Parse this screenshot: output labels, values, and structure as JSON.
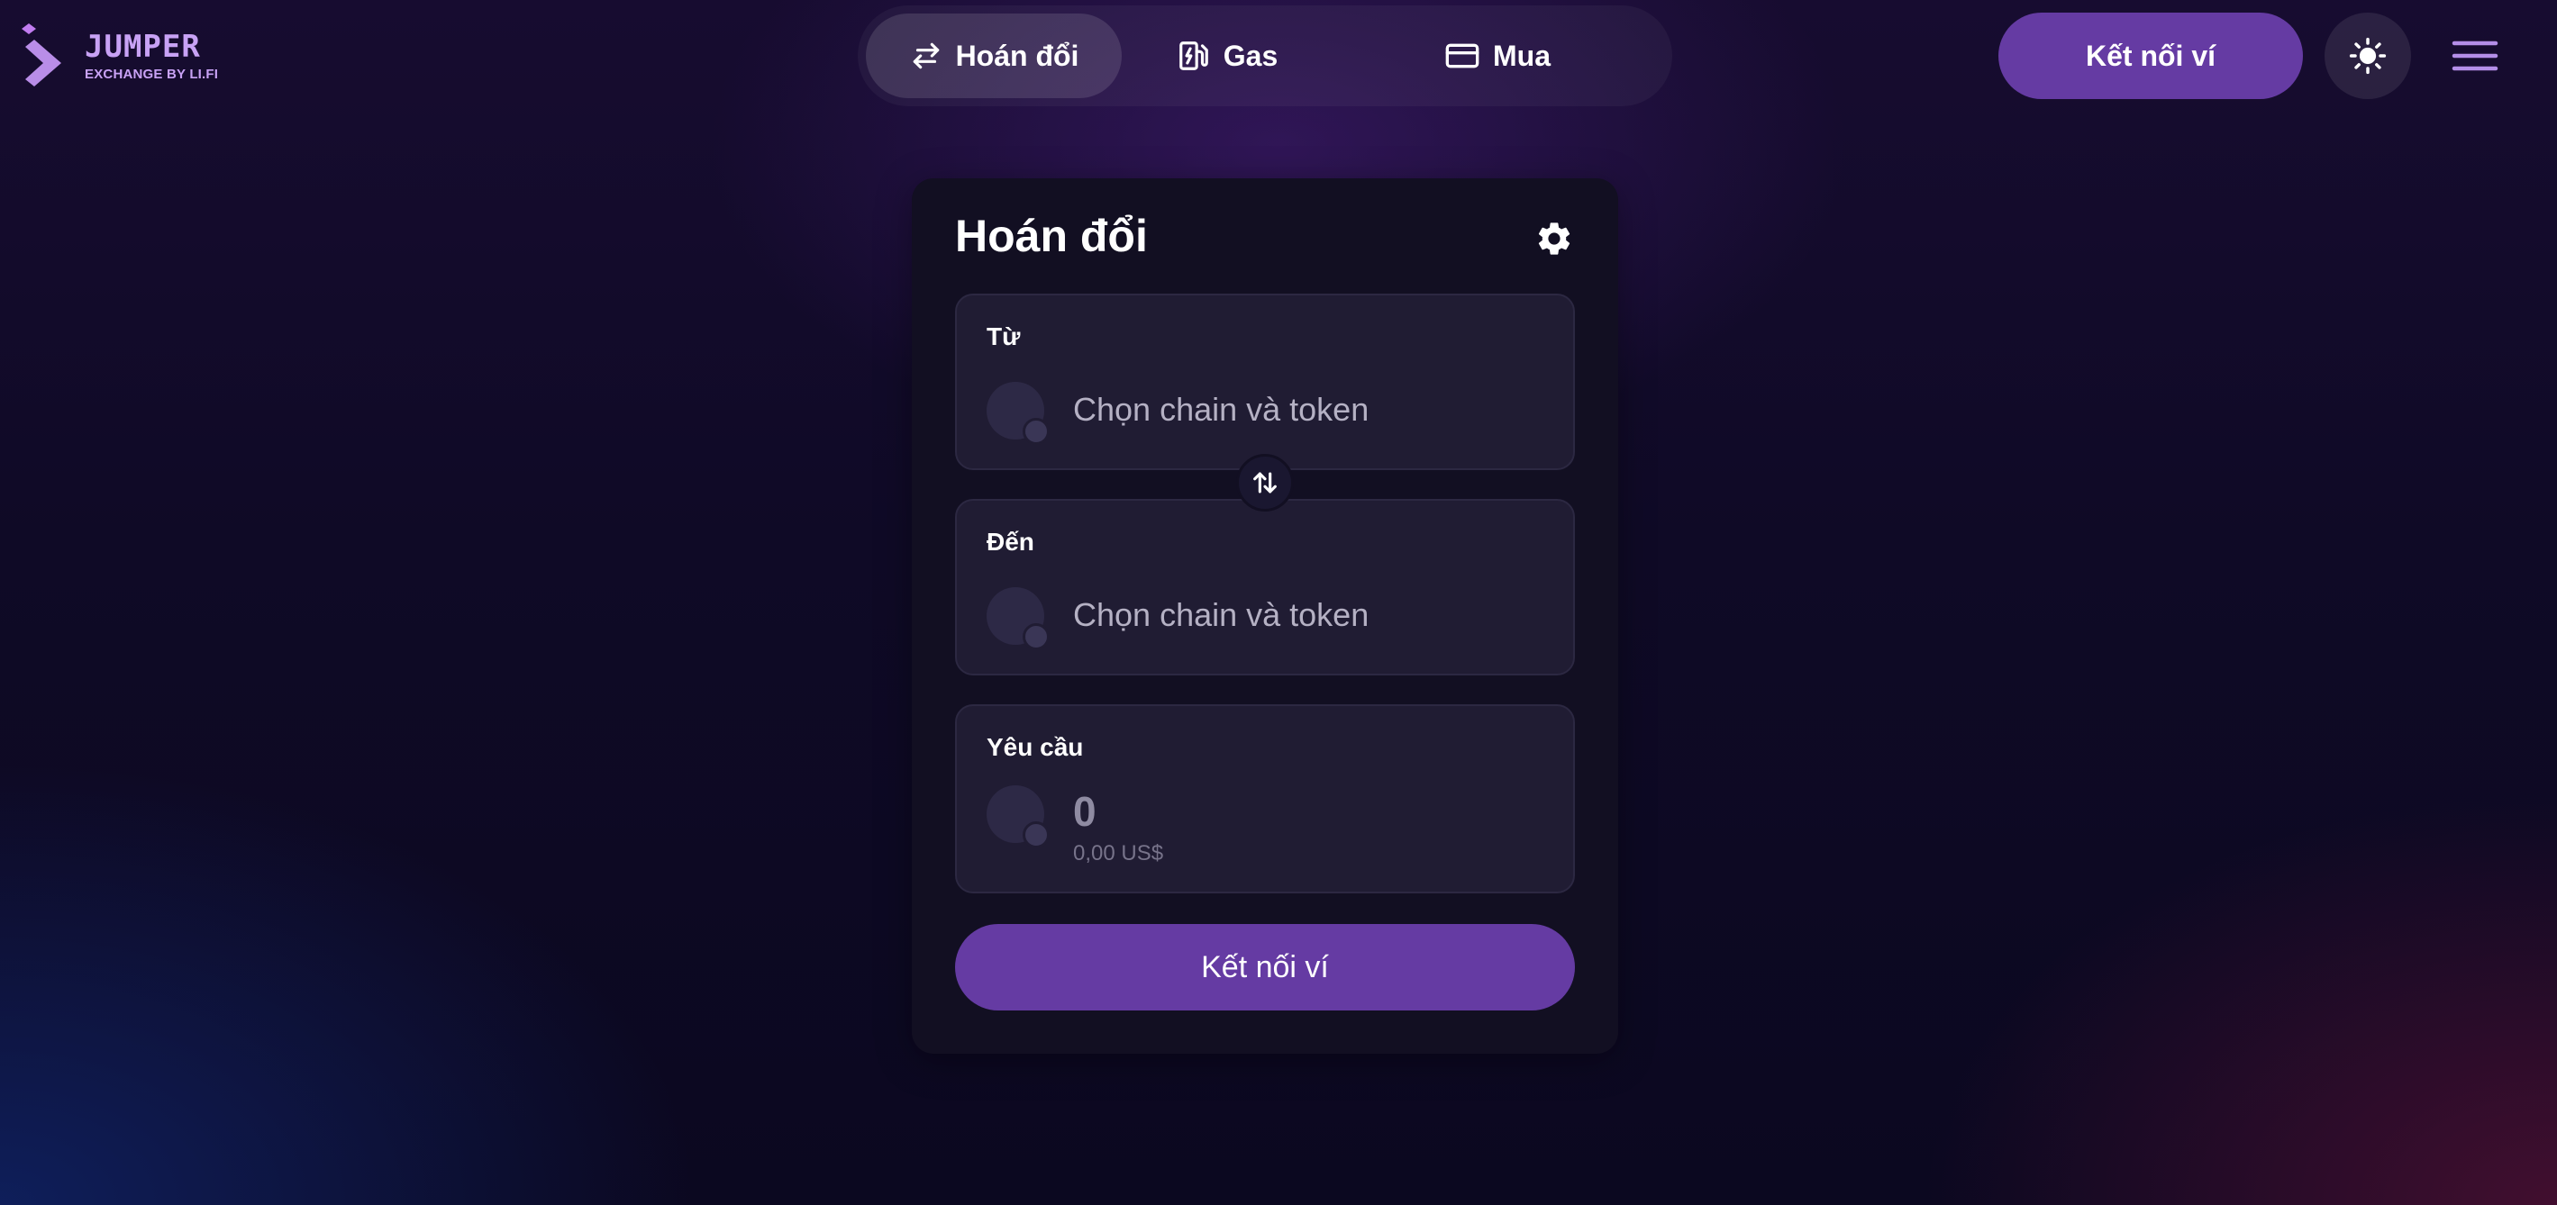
{
  "brand": {
    "name": "JUMPER",
    "tagline": "EXCHANGE BY LI.FI",
    "accent": "#c8a2f5"
  },
  "nav": {
    "tabs": [
      {
        "label": "Hoán đổi",
        "icon": "swap-arrows-icon",
        "active": true
      },
      {
        "label": "Gas",
        "icon": "fuel-pump-icon",
        "active": false
      },
      {
        "label": "Mua",
        "icon": "credit-card-icon",
        "active": false
      }
    ]
  },
  "header": {
    "connect_label": "Kết nối ví",
    "theme_icon": "sun-icon",
    "menu_icon": "hamburger-menu-icon"
  },
  "card": {
    "title": "Hoán đổi",
    "settings_icon": "gear-icon",
    "from": {
      "label": "Từ",
      "placeholder": "Chọn chain và token"
    },
    "to": {
      "label": "Đến",
      "placeholder": "Chọn chain và token"
    },
    "receive": {
      "label": "Yêu cầu",
      "amount": "0",
      "usd": "0,00 US$"
    },
    "connect_label": "Kết nối ví"
  },
  "colors": {
    "primary_button": "#653ba3",
    "card_bg": "#120f22",
    "field_bg": "#201c33"
  }
}
